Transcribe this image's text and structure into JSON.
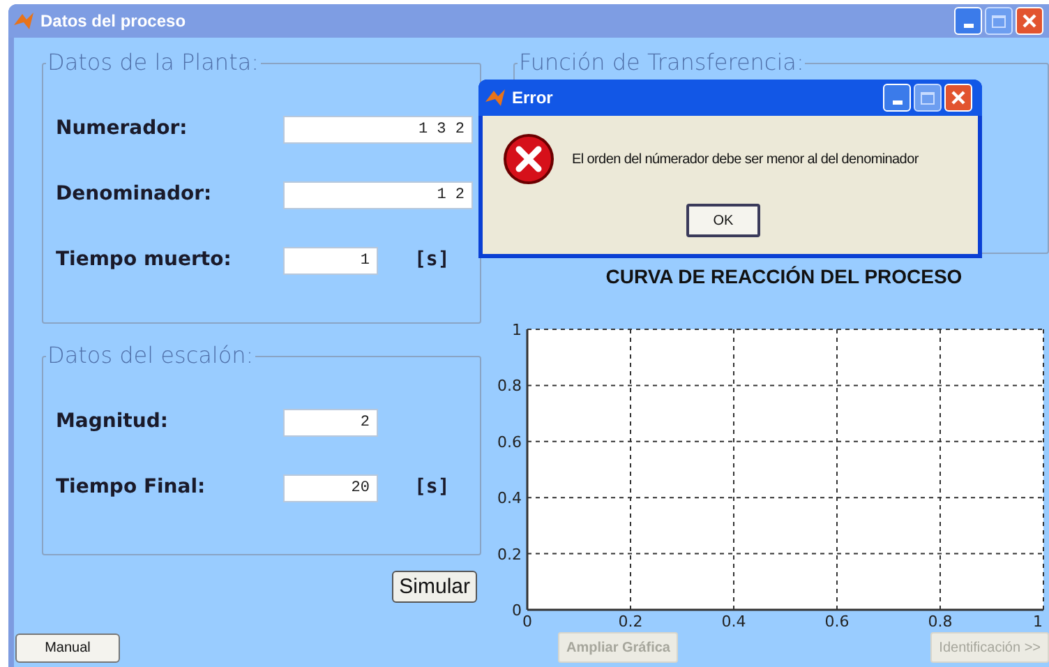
{
  "window": {
    "title": "Datos del proceso"
  },
  "plant_panel": {
    "title": "Datos de la Planta:",
    "fields": [
      {
        "kind": "wide",
        "label": "Numerador:",
        "value": "1 3 2"
      },
      {
        "kind": "wide",
        "label": "Denominador:",
        "value": "1 2"
      },
      {
        "kind": "short",
        "label": "Tiempo muerto:",
        "value": "1",
        "unit": "[s]"
      }
    ]
  },
  "step_panel": {
    "title": "Datos del escalón:",
    "fields": [
      {
        "kind": "short",
        "label": "Magnitud:",
        "value": "2"
      },
      {
        "kind": "short",
        "label": "Tiempo Final:",
        "value": "20",
        "unit": "[s]"
      }
    ]
  },
  "simulate_button": "Simular",
  "manual_button": "Manual",
  "transfer_panel": {
    "title": "Función de Transferencia:"
  },
  "chart": {
    "chart_data": {
      "type": "line",
      "title": "CURVA DE REACCIÓN DEL PROCESO",
      "xlim": [
        0,
        1
      ],
      "ylim": [
        0,
        1
      ],
      "xticks": [
        0,
        0.2,
        0.4,
        0.6,
        0.8,
        1
      ],
      "yticks": [
        0,
        0.2,
        0.4,
        0.6,
        0.8,
        1
      ],
      "grid": true
    }
  },
  "buttons": [
    {
      "label": "Ampliar Gráfica",
      "disabled": true
    },
    {
      "label": "Identificación >>",
      "disabled": true
    }
  ],
  "dialog": {
    "title": "Error",
    "message": "El orden del númerador debe ser menor al del denominador",
    "button": "OK"
  }
}
